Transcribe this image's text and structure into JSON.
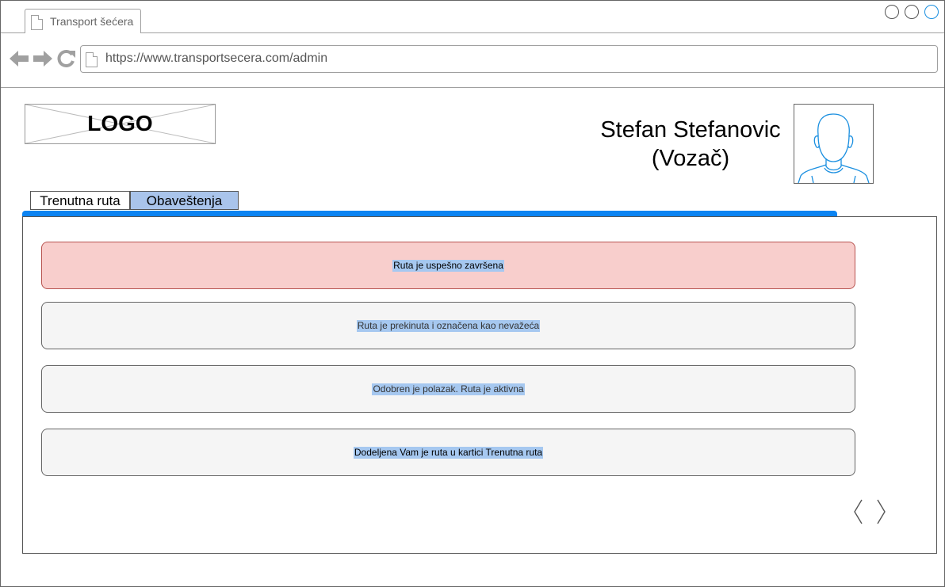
{
  "browser": {
    "tab_title": "Transport šećera",
    "url": "https://www.transportsecera.com/admin"
  },
  "header": {
    "logo_text": "LOGO",
    "user_name": "Stefan Stefanovic",
    "user_role": "(Vozač)"
  },
  "tabs": [
    {
      "label": "Trenutna ruta",
      "active": false
    },
    {
      "label": "Obaveštenja",
      "active": true
    }
  ],
  "notifications": [
    {
      "text": "Ruta je uspešno završena",
      "style": "alert"
    },
    {
      "text": "Ruta je prekinuta i označena kao nevažeća",
      "style": "normal"
    },
    {
      "text": "Odobren je polazak. Ruta je aktivna",
      "style": "normal"
    },
    {
      "text": "Dodeljena Vam je ruta u kartici Trenutna ruta",
      "style": "dark"
    }
  ],
  "pagination": {
    "prev_icon": "chevron-left-icon",
    "next_icon": "chevron-right-icon"
  },
  "colors": {
    "accent": "#0c84f2",
    "active_tab": "#a9c4eb",
    "alert_fill": "#f8cecc",
    "alert_border": "#b85450",
    "notice_fill": "#f5f5f5",
    "text_highlight": "#a6c8f0"
  }
}
